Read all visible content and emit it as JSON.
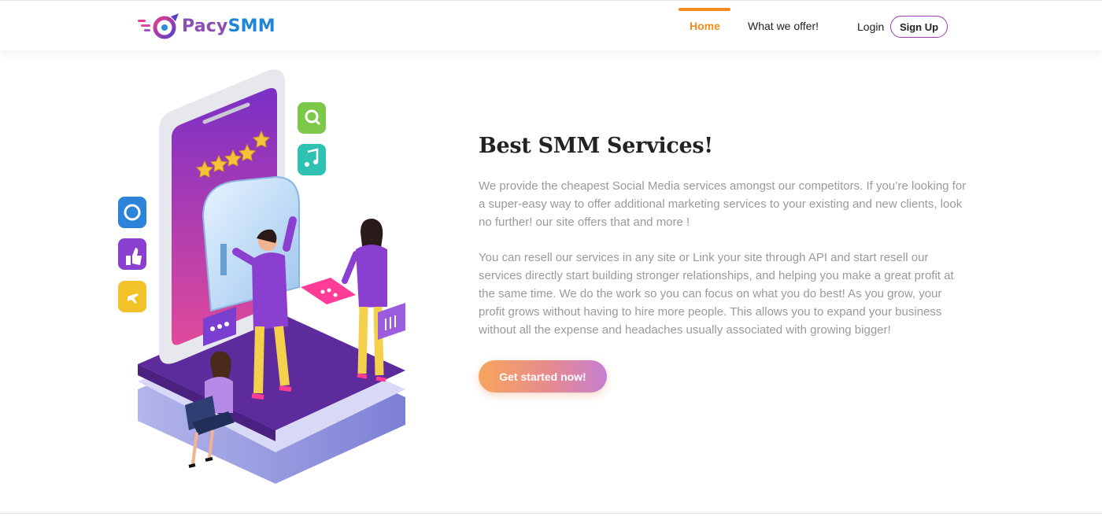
{
  "header": {
    "logo": {
      "part1": "Pacy",
      "part2": "SMM",
      "name": "PacySMM"
    },
    "nav": {
      "home": "Home",
      "offer": "What we offer!",
      "login": "Login",
      "signup": "Sign Up"
    }
  },
  "hero": {
    "title": "Best SMM Services!",
    "paragraph1": "We provide the cheapest Social Media services amongst our competitors. If you’re looking for a super-easy way to offer additional marketing services to your existing and new clients, look no further! our site offers that and more !",
    "paragraph2": "You can resell our services in any site or Link your site through API and start resell our services directly start building stronger relationships, and helping you make a great profit at the same time. We do the work so you can focus on what you do best! As you grow, your profit grows without having to hire more people. This allows you to expand your business without all the expense and headaches usually associated with growing bigger!",
    "cta": "Get started now!",
    "illustration_icons": [
      "settings-icon",
      "thumbs-up-icon",
      "airplane-icon",
      "search-icon",
      "music-note-icon",
      "star-icon",
      "chat-bubble-icon",
      "bar-chart-icon"
    ],
    "rating_stars": 5
  },
  "colors": {
    "accent": "#f28c1d",
    "brand_purple": "#8c4fb3",
    "brand_blue": "#1d86d6",
    "text_gray": "#9a9a9a"
  }
}
